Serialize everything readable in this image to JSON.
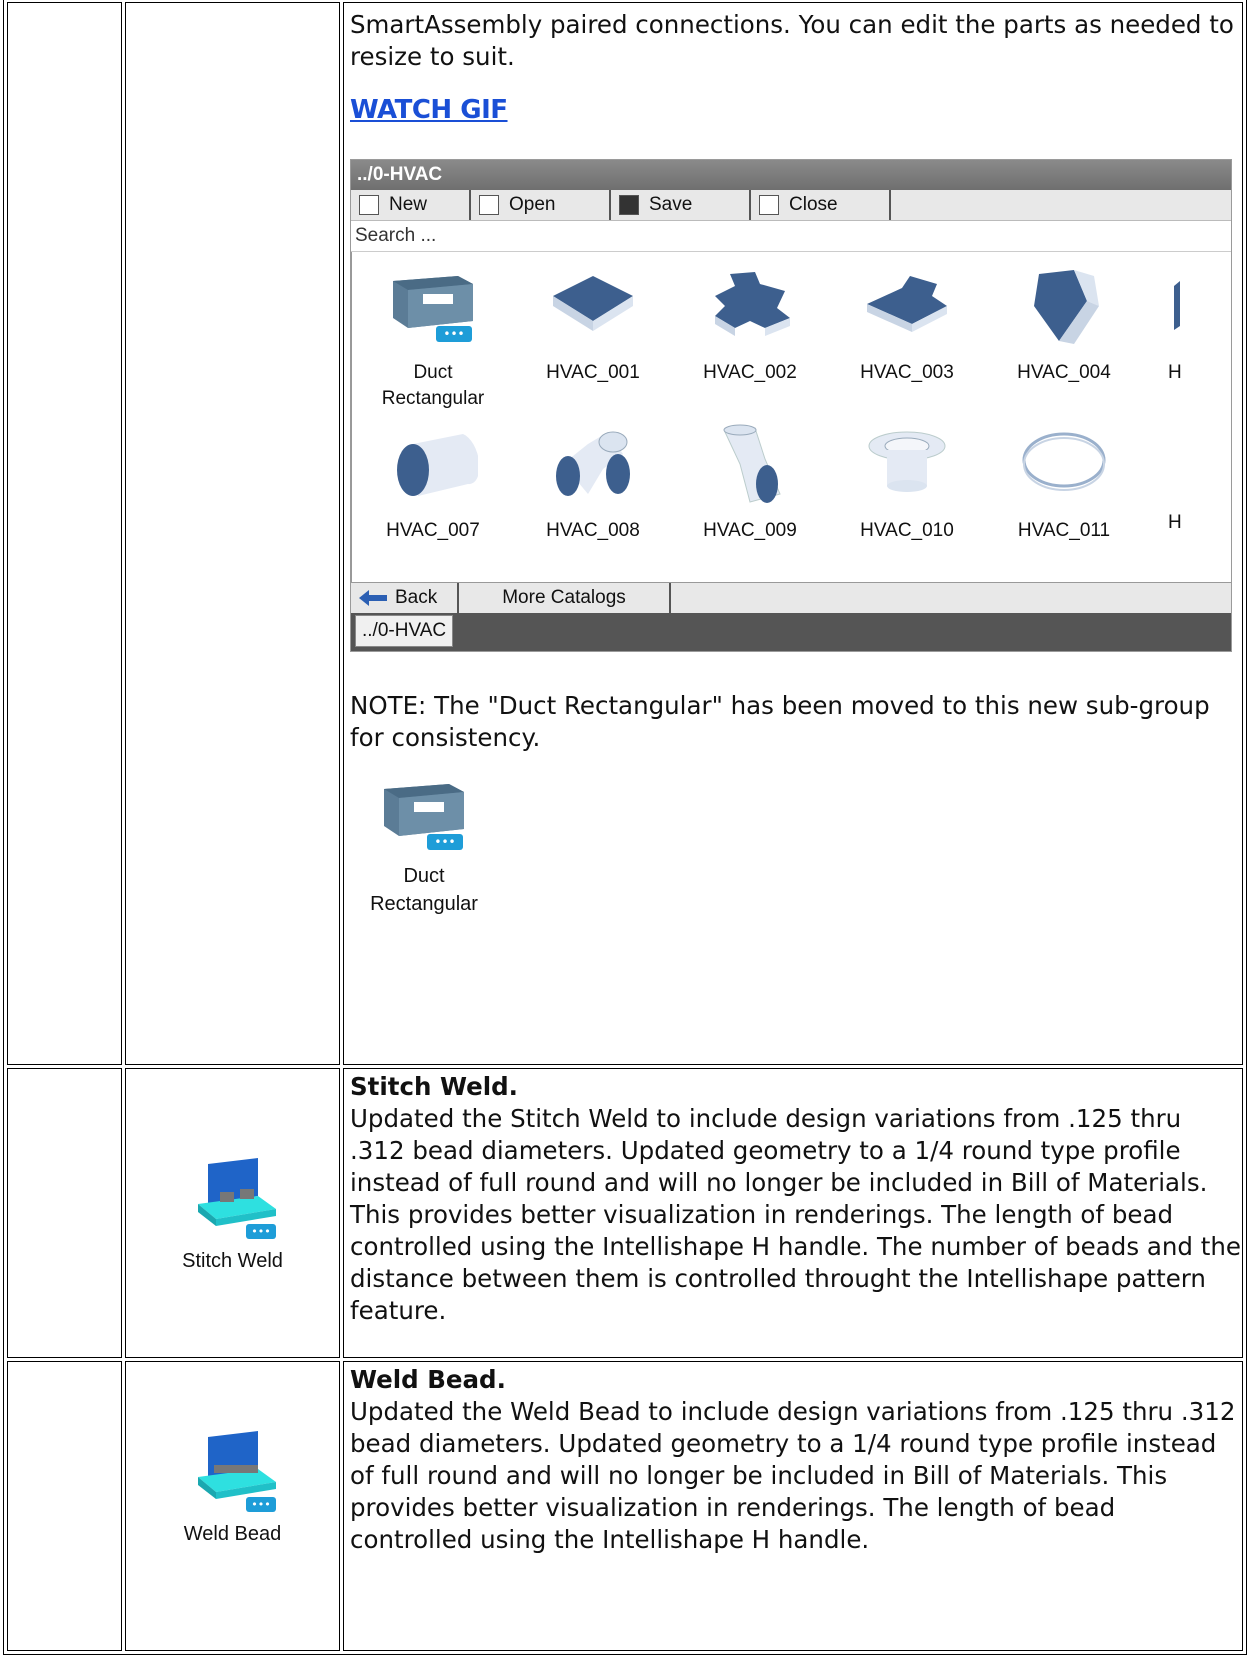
{
  "row1": {
    "intro_text": "SmartAssembly paired connections. You can edit the parts as needed to resize to suit.",
    "link_label": "WATCH GIF",
    "catalog": {
      "title": "../0-HVAC",
      "toolbar": [
        "New",
        "Open",
        "Save",
        "Close"
      ],
      "search_placeholder": "Search ...",
      "items_row1": [
        "Duct\nRectangular",
        "HVAC_001",
        "HVAC_002",
        "HVAC_003",
        "HVAC_004",
        "H"
      ],
      "items_row2": [
        "HVAC_007",
        "HVAC_008",
        "HVAC_009",
        "HVAC_010",
        "HVAC_011",
        "H"
      ],
      "back_label": "Back",
      "more_label": "More Catalogs",
      "tab_label": "../0-HVAC"
    },
    "note_text": "NOTE: The \"Duct Rectangular\" has been moved to this new sub-group for consistency.",
    "duct_line1": "Duct",
    "duct_line2": "Rectangular"
  },
  "row2": {
    "icon_label": "Stitch Weld",
    "heading": "Stitch Weld.",
    "body": "Updated the Stitch Weld to include design variations from .125 thru .312 bead diameters. Updated geometry to a 1/4 round type profile instead of full round and will no longer  be included in Bill of Materials. This provides better visualization in renderings. The length of bead controlled using the Intellishape H handle. The number of beads and the distance between them is controlled throught the Intellishape pattern feature."
  },
  "row3": {
    "icon_label": "Weld Bead",
    "heading": "Weld Bead.",
    "body": "Updated the Weld Bead to include design variations from .125 thru .312 bead diameters. Updated geometry to a 1/4 round type profile instead of full round and will no longer  be included in Bill of Materials.  This provides better visualization in renderings. The length of bead controlled using the Intellishape H handle."
  }
}
